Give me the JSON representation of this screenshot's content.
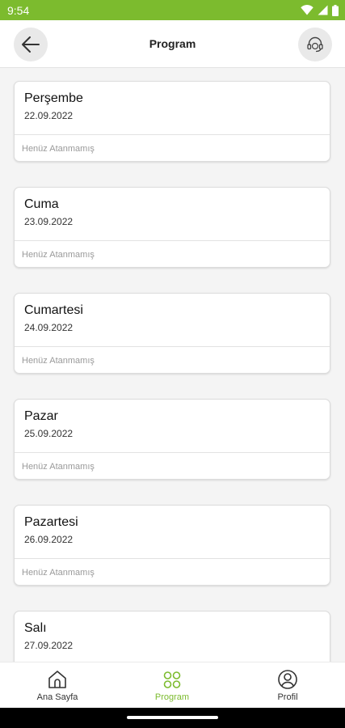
{
  "status_bar": {
    "time": "9:54"
  },
  "header": {
    "title": "Program"
  },
  "days": [
    {
      "name": "Perşembe",
      "date": "22.09.2022",
      "status": "Henüz Atanmamış"
    },
    {
      "name": "Cuma",
      "date": "23.09.2022",
      "status": "Henüz Atanmamış"
    },
    {
      "name": "Cumartesi",
      "date": "24.09.2022",
      "status": "Henüz Atanmamış"
    },
    {
      "name": "Pazar",
      "date": "25.09.2022",
      "status": "Henüz Atanmamış"
    },
    {
      "name": "Pazartesi",
      "date": "26.09.2022",
      "status": "Henüz Atanmamış"
    },
    {
      "name": "Salı",
      "date": "27.09.2022",
      "status": ""
    }
  ],
  "bottom_nav": {
    "items": [
      {
        "label": "Ana Sayfa",
        "icon": "home-icon",
        "active": false
      },
      {
        "label": "Program",
        "icon": "grid-icon",
        "active": true
      },
      {
        "label": "Profil",
        "icon": "profile-icon",
        "active": false
      }
    ],
    "active_color": "#7cbb2e",
    "inactive_color": "#333333"
  },
  "colors": {
    "accent": "#7cbb2e"
  }
}
